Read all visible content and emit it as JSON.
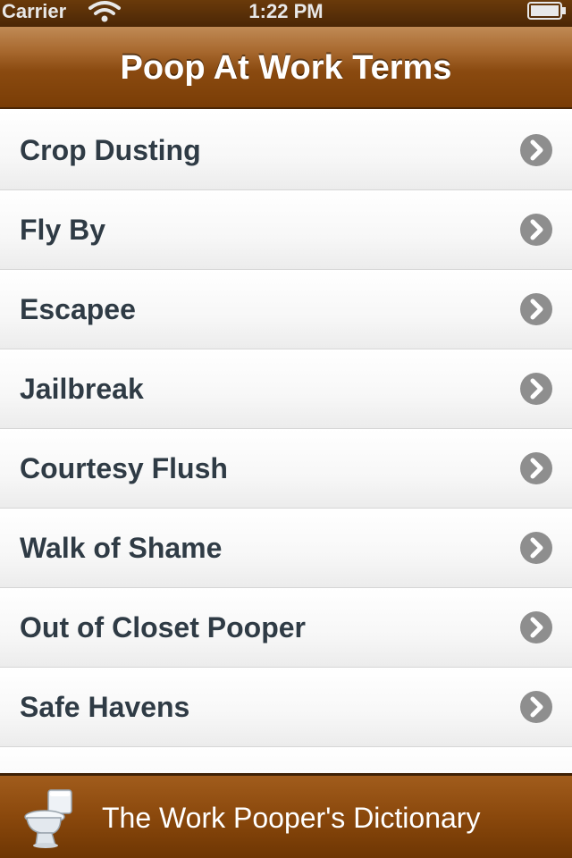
{
  "status_bar": {
    "carrier": "Carrier",
    "time": "1:22 PM",
    "wifi_icon": "wifi-icon",
    "battery_icon": "battery-icon"
  },
  "nav_bar": {
    "title": "Poop At Work Terms"
  },
  "list": {
    "disclosure_icon": "chevron-right-circle-icon",
    "items": [
      {
        "label": "Crop Dusting"
      },
      {
        "label": "Fly By"
      },
      {
        "label": "Escapee"
      },
      {
        "label": "Jailbreak"
      },
      {
        "label": "Courtesy Flush"
      },
      {
        "label": "Walk of Shame"
      },
      {
        "label": "Out of Closet Pooper"
      },
      {
        "label": "Safe Havens"
      },
      {
        "label": ""
      }
    ]
  },
  "footer": {
    "icon": "toilet-icon",
    "text": "The Work Pooper's Dictionary"
  },
  "colors": {
    "nav_brown": "#8a4a10",
    "label_text": "#2f3b45",
    "disclosure_gray": "#8e8e8e"
  }
}
